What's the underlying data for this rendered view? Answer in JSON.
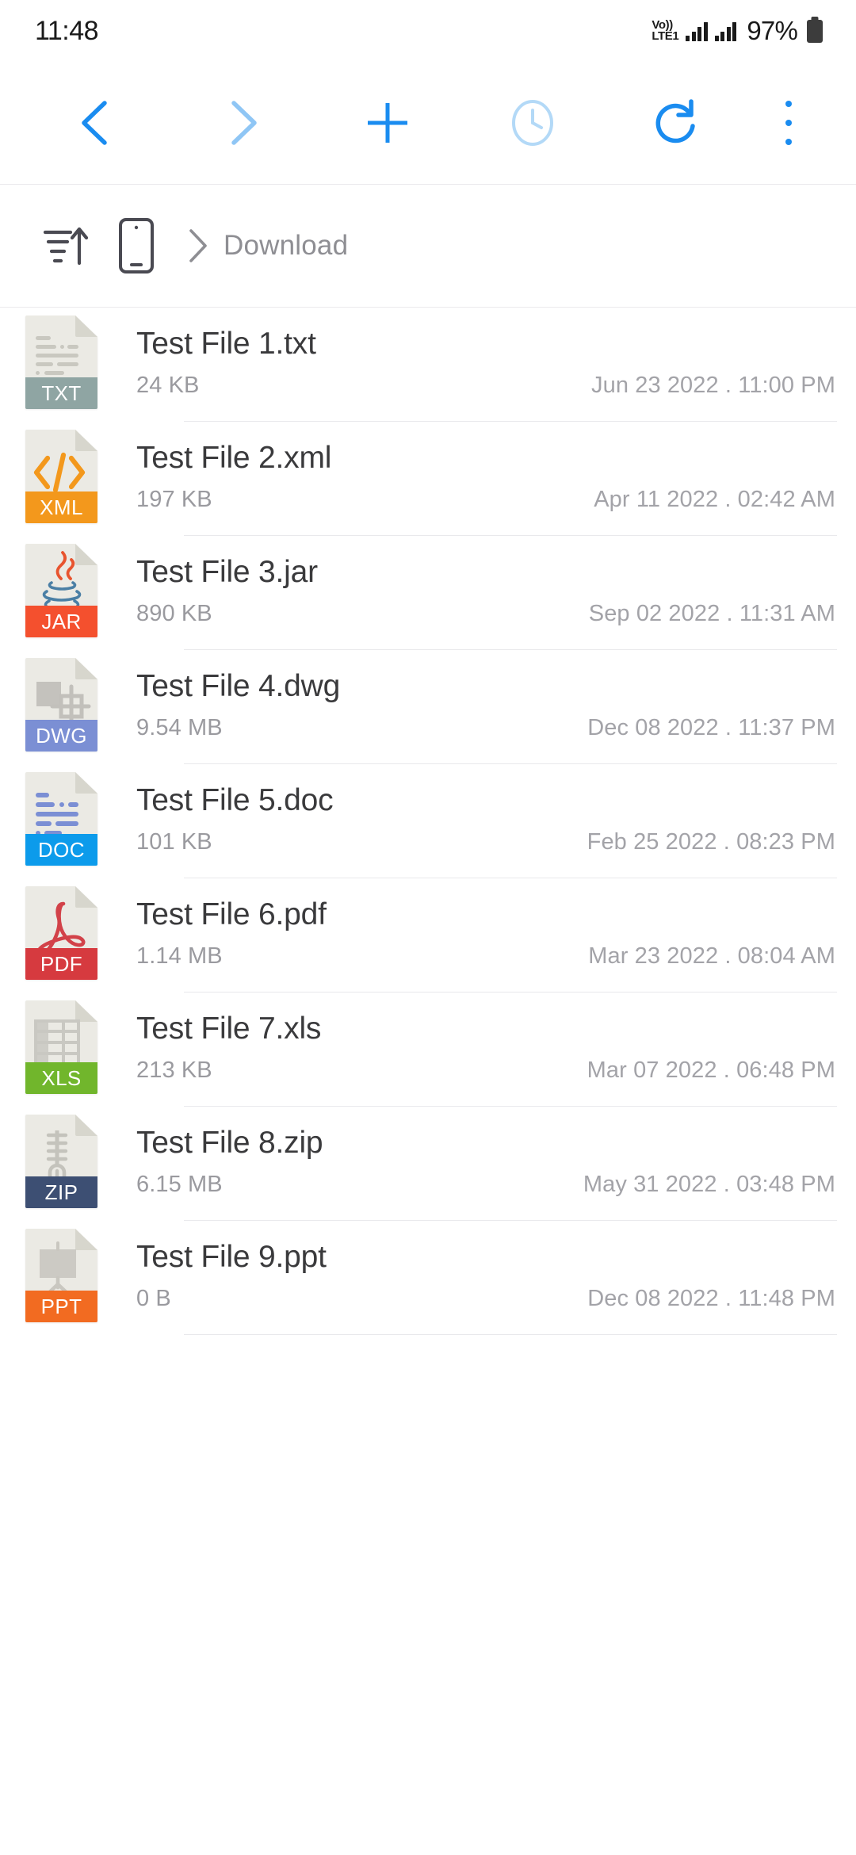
{
  "status_bar": {
    "clock": "11:48",
    "network_line1": "Vo))",
    "network_line2": "LTE1",
    "battery_percent": "97%"
  },
  "toolbar": {
    "back_label": "Back",
    "forward_label": "Forward",
    "new_label": "New",
    "recent_label": "Recent",
    "refresh_label": "Refresh",
    "more_label": "More options"
  },
  "breadcrumb": {
    "sort_label": "Sort",
    "device_label": "Internal storage",
    "path_label": "Download"
  },
  "colors": {
    "accent": "#1a8cf0",
    "accent_dim": "#8fc6f5",
    "accent_pale": "#b3d9f7",
    "text_primary": "#3a3a3c",
    "text_secondary": "#9a9a9f",
    "divider": "#e9e9ec",
    "icon_page": "#ebeae4",
    "icon_fold": "#d7d6cd"
  },
  "files": [
    {
      "name": "Test File 1.txt",
      "size": "24 KB",
      "date": "Jun 23 2022 . 11:00 PM",
      "ext": "TXT",
      "badge_color": "#8fa5a3",
      "glyph": "lines",
      "glyph_color": "#c9c8c0"
    },
    {
      "name": "Test File 2.xml",
      "size": "197 KB",
      "date": "Apr 11 2022 . 02:42 AM",
      "ext": "XML",
      "badge_color": "#f3981c",
      "glyph": "code",
      "glyph_color": "#f3981c"
    },
    {
      "name": "Test File 3.jar",
      "size": "890 KB",
      "date": "Sep 02 2022 . 11:31 AM",
      "ext": "JAR",
      "badge_color": "#f4502e",
      "glyph": "java",
      "glyph_color": "#e8542f"
    },
    {
      "name": "Test File 4.dwg",
      "size": "9.54 MB",
      "date": "Dec 08 2022 . 11:37 PM",
      "ext": "DWG",
      "badge_color": "#7b8fd4",
      "glyph": "cad",
      "glyph_color": "#c2c0bb"
    },
    {
      "name": "Test File 5.doc",
      "size": "101 KB",
      "date": "Feb 25 2022 . 08:23 PM",
      "ext": "DOC",
      "badge_color": "#0c9beb",
      "glyph": "doclines",
      "glyph_color": "#7b8fd4"
    },
    {
      "name": "Test File 6.pdf",
      "size": "1.14 MB",
      "date": "Mar 23 2022 . 08:04 AM",
      "ext": "PDF",
      "badge_color": "#d63a3f",
      "glyph": "acrobat",
      "glyph_color": "#d24249"
    },
    {
      "name": "Test File 7.xls",
      "size": "213 KB",
      "date": "Mar 07 2022 . 06:48 PM",
      "ext": "XLS",
      "badge_color": "#71b62c",
      "glyph": "sheet",
      "glyph_color": "#c9c8c2"
    },
    {
      "name": "Test File 8.zip",
      "size": "6.15 MB",
      "date": "May 31 2022 . 03:48 PM",
      "ext": "ZIP",
      "badge_color": "#3d4f73",
      "glyph": "zipper",
      "glyph_color": "#c4c3bc"
    },
    {
      "name": "Test File 9.ppt",
      "size": "0 B",
      "date": "Dec 08 2022 . 11:48 PM",
      "ext": "PPT",
      "badge_color": "#f26b21",
      "glyph": "easel",
      "glyph_color": "#c9c7c0"
    }
  ]
}
